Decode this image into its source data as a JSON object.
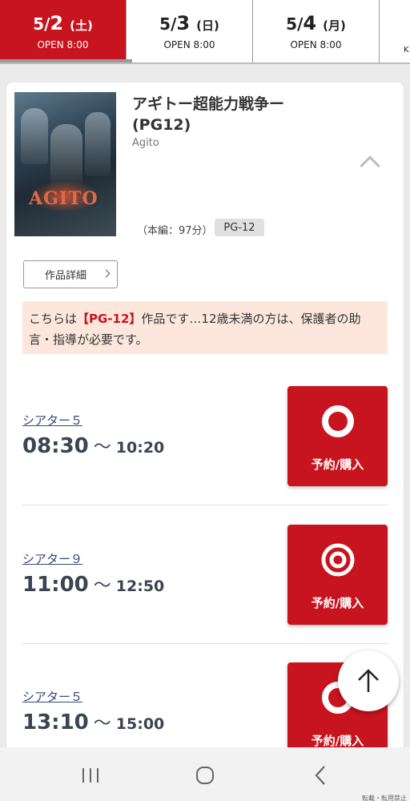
{
  "date_tabs": [
    {
      "month": "5/",
      "day": "2",
      "weekday": "(土)",
      "open": "OPEN 8:00",
      "active": true
    },
    {
      "month": "5/",
      "day": "3",
      "weekday": "(日)",
      "open": "OPEN 8:00",
      "active": false
    },
    {
      "month": "5/",
      "day": "4",
      "weekday": "(月)",
      "open": "OPEN 8:00",
      "active": false
    },
    {
      "partial_text": "K"
    }
  ],
  "movie": {
    "title_line1": "アギトー超能力戦争ー",
    "title_line2": "(PG12)",
    "subtitle": "Agito",
    "poster_logo": "AGITO",
    "runtime": "（本編：97分）",
    "rating": "PG-12",
    "detail_button": "作品詳細",
    "notice_prefix": "こちらは",
    "notice_rating": "【PG-12】",
    "notice_suffix": "作品です…12歳未満の方は、保護者の助言・指導が必要です。"
  },
  "showings": [
    {
      "theater": "シアター５",
      "start": "08:30",
      "tilde": "〜",
      "end": "10:20",
      "buy_label": "予約/購入",
      "availability_icon": "circle-icon"
    },
    {
      "theater": "シアター９",
      "start": "11:00",
      "tilde": "〜",
      "end": "12:50",
      "buy_label": "予約/購入",
      "availability_icon": "double-circle-icon"
    },
    {
      "theater": "シアター５",
      "start": "13:10",
      "tilde": "〜",
      "end": "15:00",
      "buy_label": "予約/購入",
      "availability_icon": "circle-icon"
    }
  ],
  "colors": {
    "accent": "#c8141e",
    "notice_bg": "#fde7dc",
    "link": "#334a7a"
  },
  "footer_note": "転載・転用禁止"
}
